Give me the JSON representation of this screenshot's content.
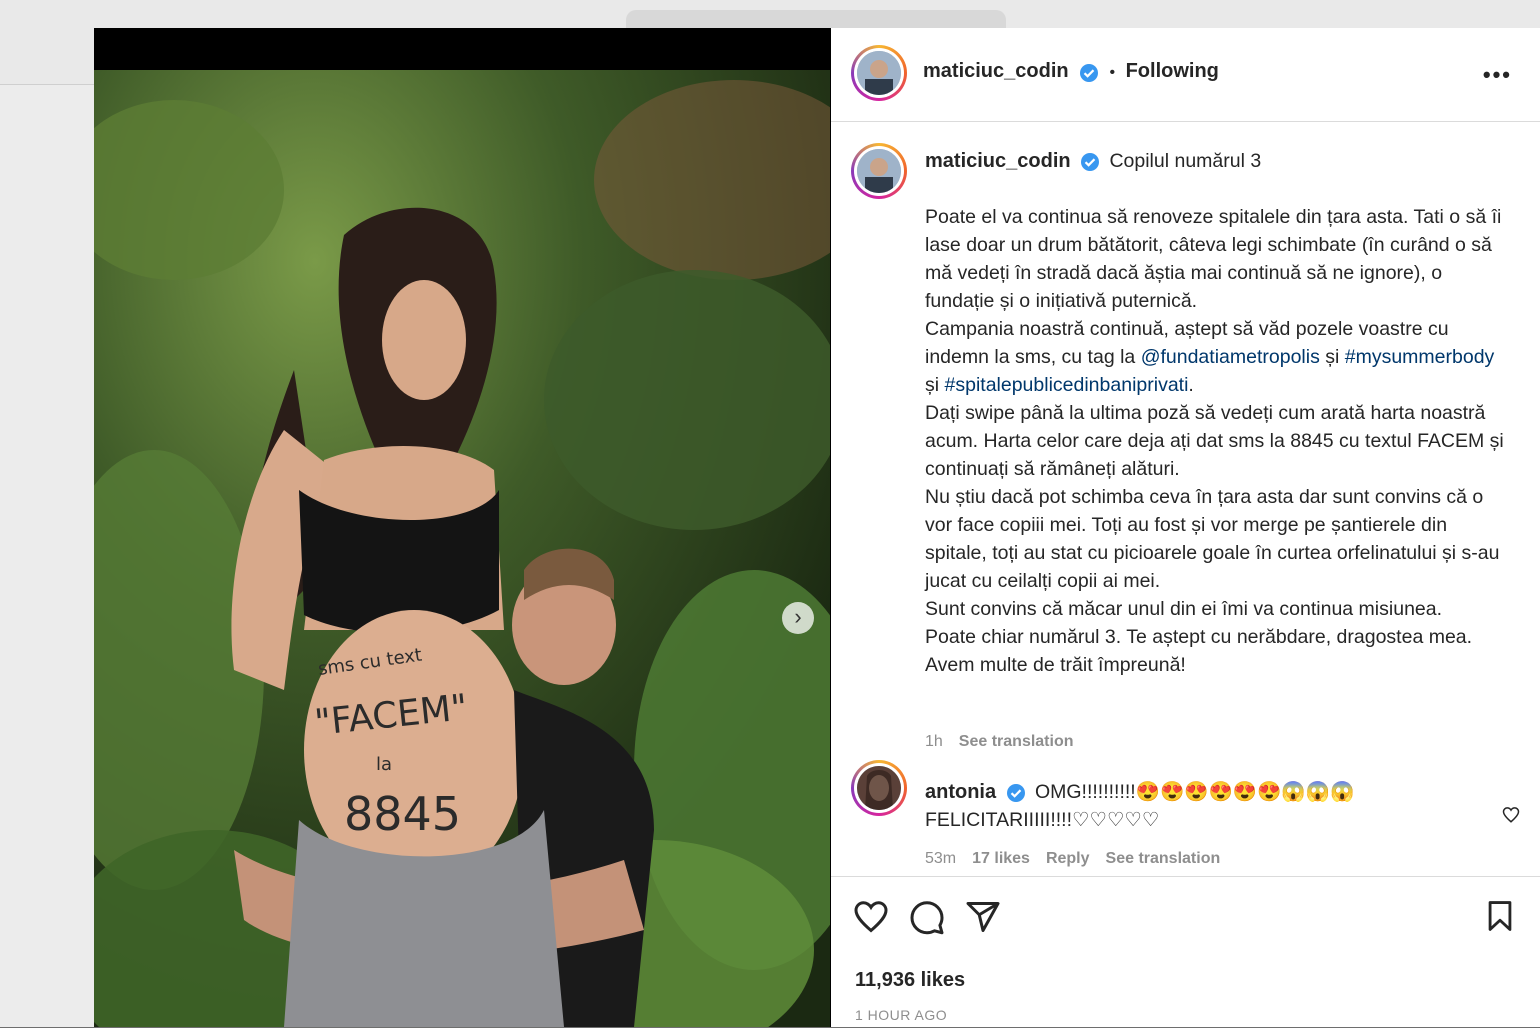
{
  "post": {
    "username": "maticiuc_codin",
    "separator": "•",
    "follow_status": "Following",
    "more_icon": "•••"
  },
  "caption": {
    "username": "maticiuc_codin",
    "title": "Copilul numărul 3",
    "p1": "Poate el va continua să renoveze spitalele din țara asta. Tati o să îi lase doar un drum bătătorit, câteva legi schimbate (în curând o să mă vedeți în stradă dacă ăștia mai continuă să ne ignore), o fundație și o inițiativă puternică.",
    "p2_pre": "Campania noastră continuă, aștept să văd pozele voastre cu indemn la sms, cu tag la ",
    "p2_mention": "@fundatiametropolis",
    "p2_mid1": " și ",
    "p2_tag1": "#mysummerbody",
    "p2_mid2": " și ",
    "p2_tag2": "#spitalepublicedinbaniprivati",
    "p2_end": ".",
    "p3": "Dați swipe până la ultima poză să vedeți cum arată harta noastră acum. Harta celor care deja ați dat sms la 8845 cu textul FACEM și continuați să rămâneți alături.",
    "p4": "Nu știu dacă pot schimba ceva în țara asta dar sunt convins că o vor face copiii mei. Toți au fost și vor merge pe șantierele din spitale, toți au stat cu picioarele goale în curtea orfelinatului și s-au jucat cu ceilalți copii ai mei.",
    "p5": "Sunt convins că măcar unul din ei îmi va continua misiunea.",
    "p6": "Poate chiar numărul 3. Te aștept cu nerăbdare, dragostea mea.",
    "p7": "Avem multe de trăit împreună!",
    "time": "1h",
    "see_translation": "See translation"
  },
  "comment": {
    "username": "antonia",
    "text_line1": "OMG!!!!!!!!!!😍😍😍😍😍😍😱😱😱",
    "text_line2": "FELICITARIIIII!!!!♡♡♡♡♡",
    "time": "53m",
    "likes": "17 likes",
    "reply": "Reply",
    "see_translation": "See translation"
  },
  "footer": {
    "likes": "11,936 likes",
    "time": "1 HOUR AGO"
  },
  "media": {
    "belly_text_line1": "sms cu text",
    "belly_text_line2": "\"FACEM\"",
    "belly_text_line3": "la",
    "belly_text_line4": "8845",
    "next_icon": "›"
  },
  "colors": {
    "link": "#00376b",
    "verified": "#3897f0",
    "text": "#262626",
    "muted": "#8e8e8e"
  }
}
